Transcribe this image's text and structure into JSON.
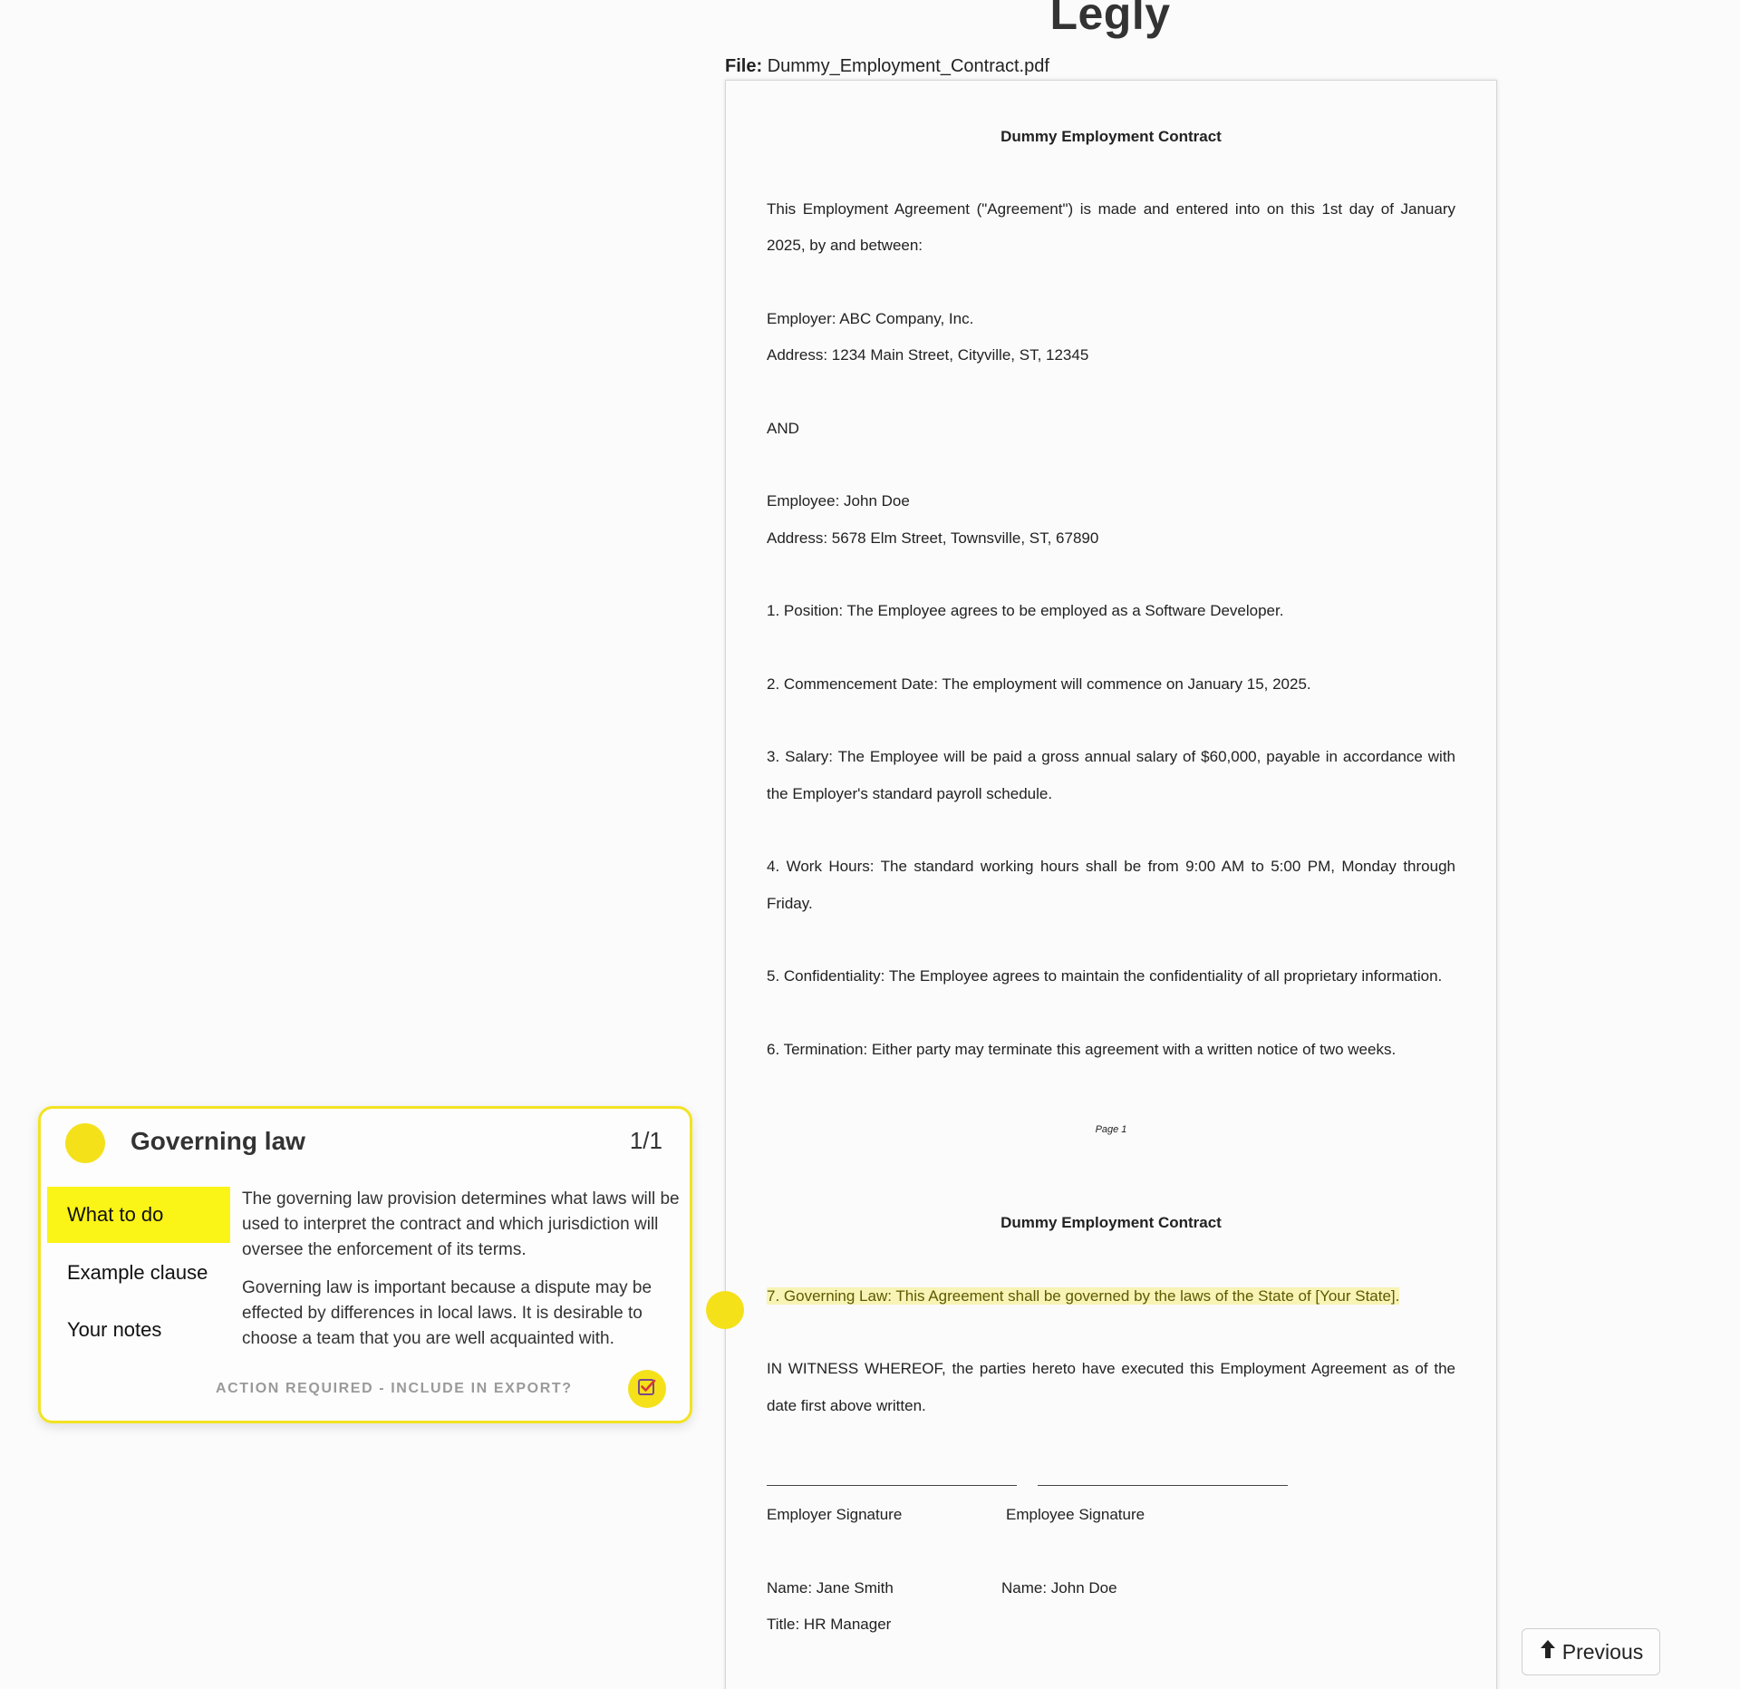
{
  "app": {
    "title": "Legly"
  },
  "file": {
    "label": "File:",
    "name": "Dummy_Employment_Contract.pdf"
  },
  "document": {
    "page1": {
      "title": "Dummy Employment Contract",
      "intro_1": "This Employment Agreement (\"Agreement\") is made and entered into on this 1st day of January",
      "intro_2": "2025, by and between:",
      "employer": "Employer: ABC Company, Inc.",
      "employer_address": "Address: 1234 Main Street, Cityville, ST, 12345",
      "and": "AND",
      "employee": "Employee: John Doe",
      "employee_address": "Address: 5678 Elm Street, Townsville, ST, 67890",
      "clause_1": "1. Position: The Employee agrees to be employed as a Software Developer.",
      "clause_2": "2. Commencement Date: The employment will commence on January 15, 2025.",
      "clause_3a": "3. Salary: The Employee will be paid a gross annual salary of $60,000, payable in accordance with",
      "clause_3b": "the Employer's standard payroll schedule.",
      "clause_4a": "4. Work Hours: The standard working hours shall be from 9:00 AM to 5:00 PM, Monday through",
      "clause_4b": "Friday.",
      "clause_5": "5. Confidentiality: The Employee agrees to maintain the confidentiality of all proprietary information.",
      "clause_6": "6. Termination: Either party may terminate this agreement with a written notice of two weeks.",
      "page_number": "Page 1"
    },
    "page2": {
      "title": "Dummy Employment Contract",
      "clause_7": "7. Governing Law: This Agreement shall be governed by the laws of the State of [Your State].",
      "witness_1": "IN WITNESS WHEREOF, the parties hereto have executed this Employment Agreement as of the",
      "witness_2": "date first above written.",
      "employer_signature": "Employer Signature",
      "employee_signature": "Employee Signature",
      "employer_name": "Name: Jane Smith",
      "employee_name": "Name: John Doe",
      "employer_title": "Title: HR Manager"
    }
  },
  "card": {
    "title": "Governing law",
    "count": "1/1",
    "tabs": [
      "What to do",
      "Example clause",
      "Your notes"
    ],
    "body_p1": "The governing law provision determines what laws will be used to interpret the contract and which jurisdiction will oversee the enforcement of its terms.",
    "body_p2": "Governing law is important because a dispute may be effected by differences in local laws. It is desirable to choose a team that you are well acquainted with.",
    "action_label": "ACTION REQUIRED - INCLUDE IN EXPORT?",
    "checked": true
  },
  "nav": {
    "previous_label": "Previous"
  },
  "colors": {
    "accent": "#f4e11a",
    "highlight": "#f7f4b6",
    "tab_active": "#fbf417"
  }
}
